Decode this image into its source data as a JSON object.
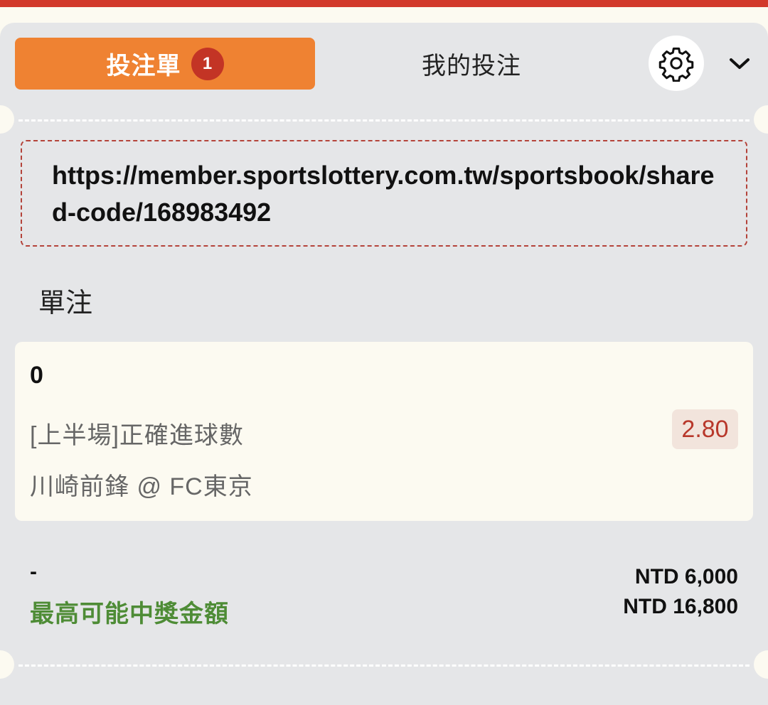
{
  "tabs": {
    "betslip_label": "投注單",
    "betslip_count": "1",
    "mybets_label": "我的投注"
  },
  "icons": {
    "settings": "gear-icon",
    "collapse": "chevron-down-icon"
  },
  "share": {
    "url": "https://member.sportslottery.com.tw/sportsbook/shared-code/168983492"
  },
  "section": {
    "title": "單注"
  },
  "bet": {
    "selection": "0",
    "market": "[上半場]正確進球數",
    "match": "川崎前鋒 @ FC東京",
    "odds": "2.80"
  },
  "summary": {
    "stake_label": "-",
    "stake_value": "NTD 6,000",
    "max_win_label": "最高可能中獎金額",
    "max_win_value": "NTD 16,800"
  },
  "colors": {
    "accent": "#ef8232",
    "badge": "#c33425",
    "top_bar": "#d2392b",
    "win_green": "#4e8c36",
    "odds_red": "#b8382b"
  }
}
